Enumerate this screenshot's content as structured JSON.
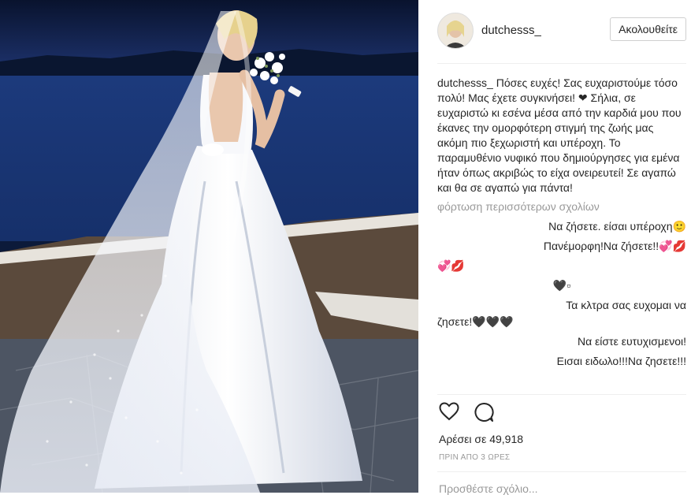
{
  "post": {
    "username": "dutchesss_",
    "follow_label": "Ακολουθείτε",
    "caption_user": "dutchesss_",
    "caption_text": "Πόσες ευχές! Σας ευχαριστούμε τόσο πολύ! Μας έχετε συγκινήσει! ❤ Σήλια, σε ευχαριστώ κι εσένα μέσα από την καρδιά μου που έκανες την ομορφότερη στιγμή της ζωής μας ακόμη πιο ξεχωριστή και υπέροχη. Το παραμυθένιο νυφικό που δημιούργησες για εμένα ήταν όπως ακριβώς το είχα ονειρευτεί! Σε αγαπώ και θα σε αγαπώ για πάντα!",
    "load_more": "φόρτωση περισσότερων σχολίων",
    "comments": [
      {
        "text": "Να ζήσετε. είσαι υπέροχη🙂",
        "align": "right"
      },
      {
        "text": "Πανέμορφη!Να ζήσετε!!💞💋",
        "align": "right"
      },
      {
        "text": "💞💋",
        "align": "left"
      },
      {
        "text": "🖤▫",
        "align": "right"
      },
      {
        "text": "Τα κλτρα σας ευχομαι να",
        "align": "right"
      },
      {
        "text": "ζησετε!🖤🖤🖤",
        "align": "left"
      },
      {
        "text": "Να είστε ευτυχισμενοι!",
        "align": "right"
      },
      {
        "text": "Εισαι ειδωλο!!!Να ζησετε!!!",
        "align": "right"
      }
    ],
    "likes_text": "Αρέσει σε 49,918",
    "time_text": "ΠΡΙΝ ΑΠΟ 3 ΩΡΕΣ",
    "add_comment_placeholder": "Προσθέστε σχόλιο..."
  },
  "icons": {
    "like": "heart-icon",
    "comment": "comment-bubble-icon"
  },
  "colors": {
    "text": "#262626",
    "muted": "#999999",
    "border": "#efefef"
  }
}
